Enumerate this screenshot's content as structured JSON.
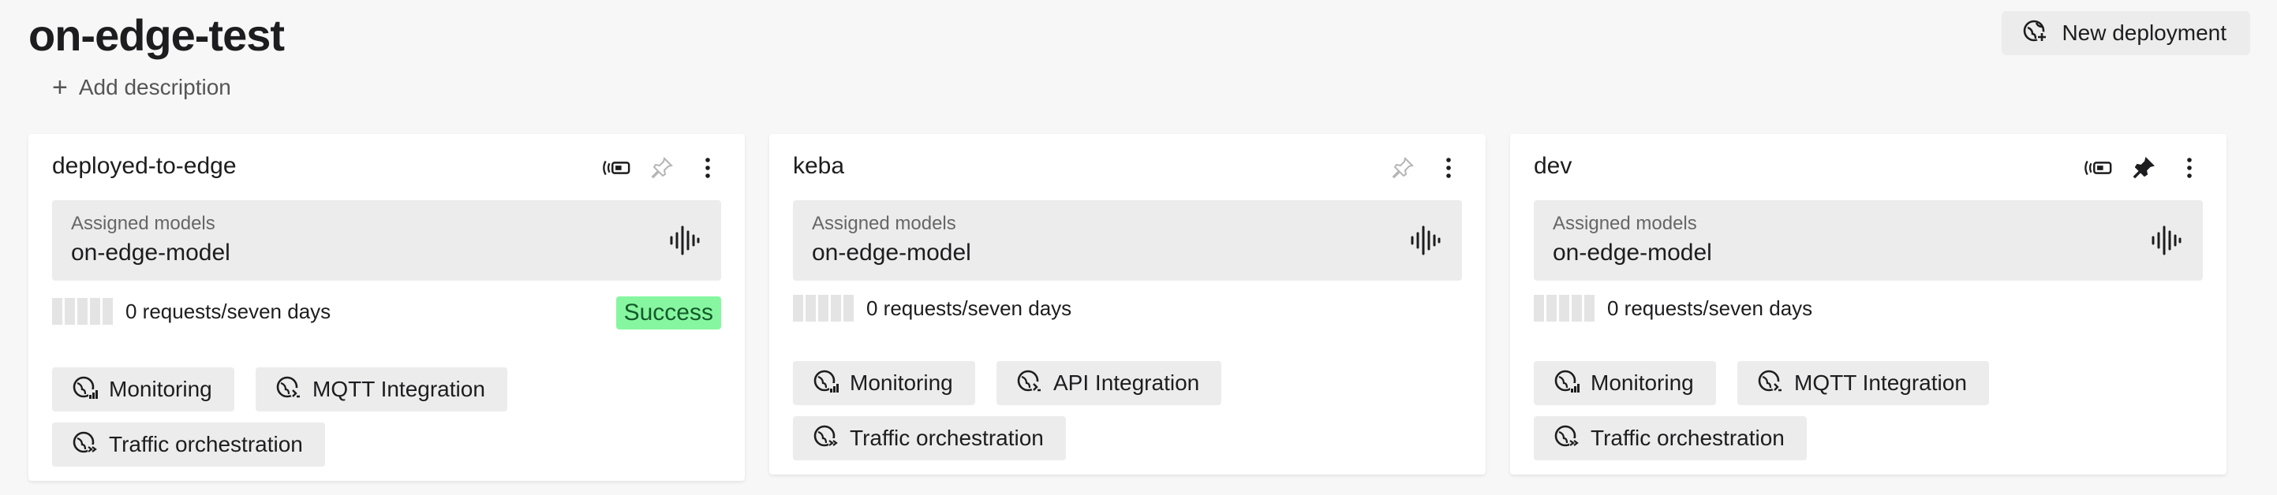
{
  "header": {
    "title": "on-edge-test",
    "add_description": "Add description",
    "new_deployment": "New deployment"
  },
  "labels": {
    "assigned_models": "Assigned models"
  },
  "cards": [
    {
      "name": "deployed-to-edge",
      "model": "on-edge-model",
      "requests": "0 requests/seven days",
      "status": "Success",
      "chips": [
        "Monitoring",
        "MQTT Integration",
        "Traffic orchestration"
      ],
      "icons": [
        "edge-device-icon",
        "pin-outline-icon",
        "more-vertical-icon"
      ]
    },
    {
      "name": "keba",
      "model": "on-edge-model",
      "requests": "0 requests/seven days",
      "chips": [
        "Monitoring",
        "API Integration",
        "Traffic orchestration"
      ],
      "icons": [
        "pin-outline-icon",
        "more-vertical-icon"
      ]
    },
    {
      "name": "dev",
      "model": "on-edge-model",
      "requests": "0 requests/seven days",
      "chips": [
        "Monitoring",
        "MQTT Integration",
        "Traffic orchestration"
      ],
      "icons": [
        "edge-device-icon",
        "pin-filled-icon",
        "more-vertical-icon"
      ]
    }
  ],
  "colors": {
    "success_bg": "#86f7a0",
    "chip_bg": "#ececec",
    "page_bg": "#f7f7f7"
  }
}
